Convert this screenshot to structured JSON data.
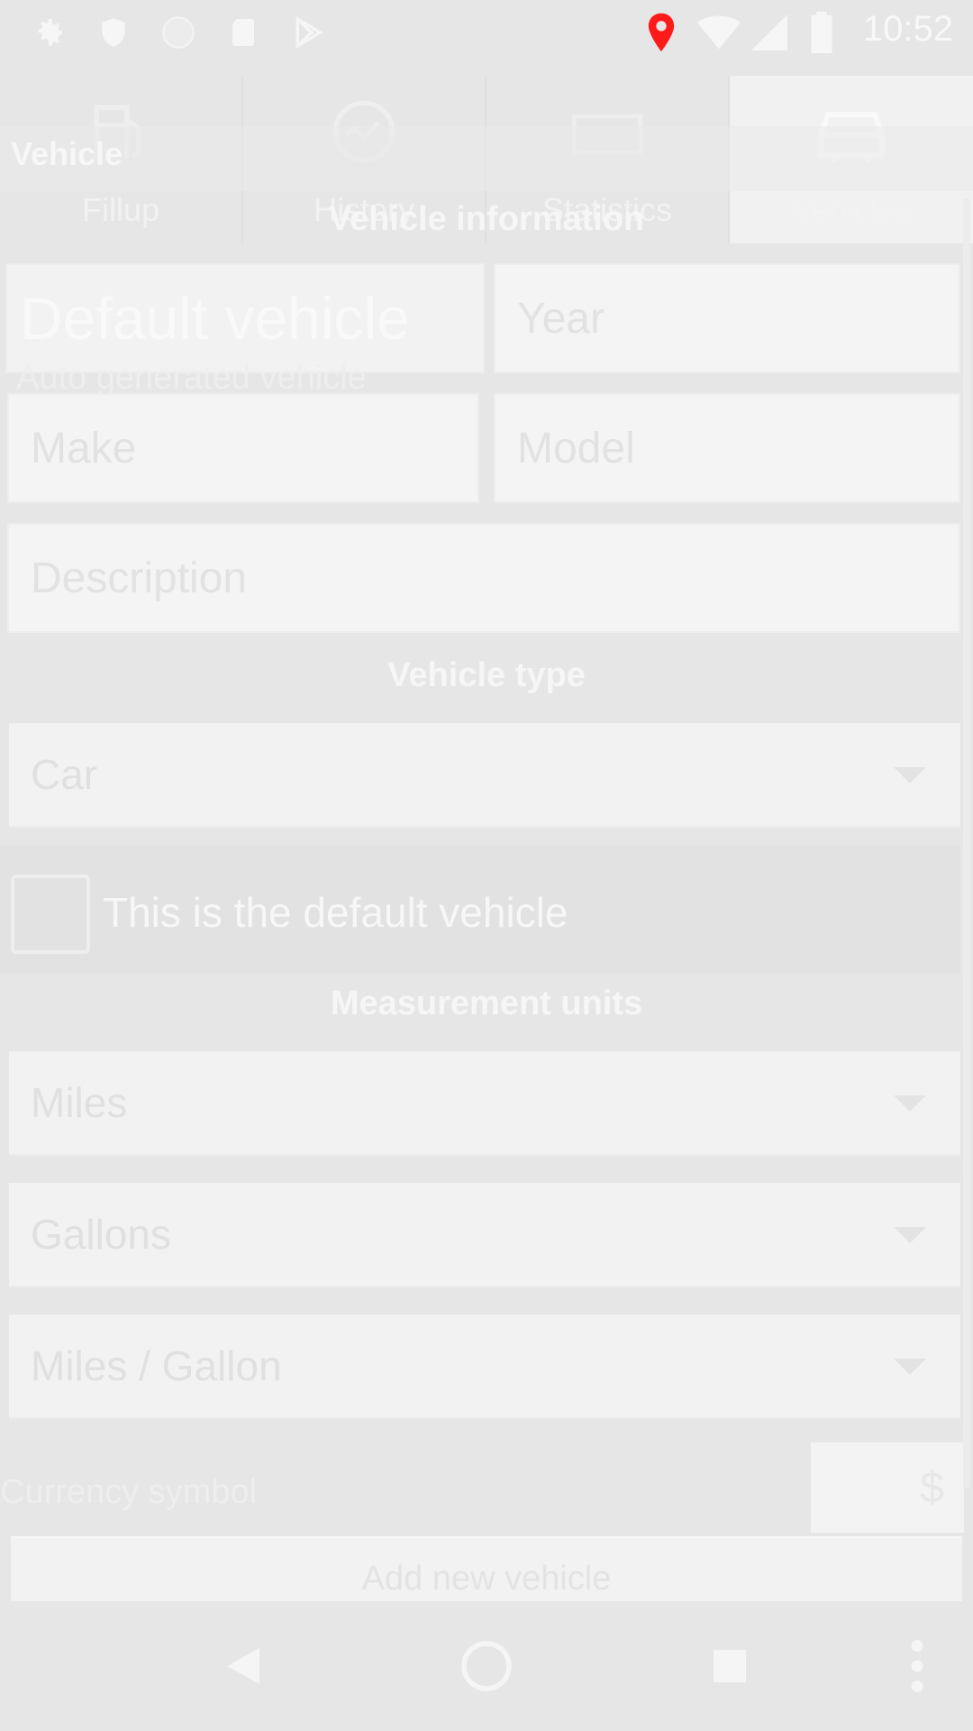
{
  "status_bar": {
    "time": "10:52",
    "icons": [
      "gear-icon",
      "shield-icon",
      "circle-icon",
      "sd-card-icon",
      "play-store-icon",
      "location-pin-icon",
      "wifi-icon",
      "signal-icon",
      "battery-icon"
    ],
    "location_color": "#ff1a1a"
  },
  "tabs": [
    {
      "label": "Fillup",
      "icon": "fuel-pump-icon"
    },
    {
      "label": "History",
      "icon": "gauge-icon"
    },
    {
      "label": "Statistics",
      "icon": "chart-icon"
    },
    {
      "label": "Vehicles",
      "icon": "car-icon"
    }
  ],
  "dialog": {
    "title": "Vehicle",
    "sections": {
      "info": "Vehicle information",
      "type": "Vehicle type",
      "units": "Measurement units"
    },
    "name_value": "Default vehicle",
    "name_subtitle": "Auto generated vehicle",
    "year_placeholder": "Year",
    "make_placeholder": "Make",
    "model_placeholder": "Model",
    "description_placeholder": "Description",
    "vehicle_type": "Car",
    "default_checkbox_label": "This is the default vehicle",
    "default_checked": false,
    "distance_unit": "Miles",
    "volume_unit": "Gallons",
    "economy_unit": "Miles / Gallon",
    "currency_label": "Currency symbol",
    "currency_value": "$",
    "add_button": "Add new vehicle"
  },
  "nav": {
    "icons": [
      "back-icon",
      "home-icon",
      "recents-icon",
      "overflow-menu-icon"
    ]
  }
}
